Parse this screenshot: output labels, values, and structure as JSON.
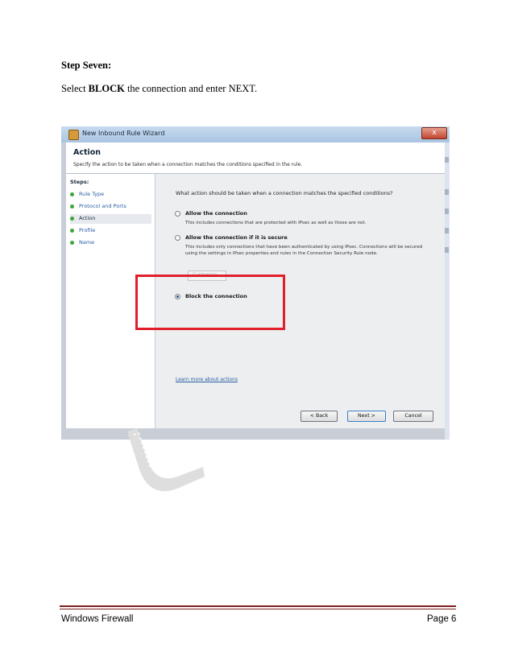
{
  "document": {
    "step_title": "Step Seven:",
    "instruction_prefix": "Select ",
    "instruction_bold": "BLOCK",
    "instruction_suffix": " the connection and enter NEXT."
  },
  "dialog": {
    "window_title": "New Inbound Rule Wizard",
    "close_label": "x",
    "header_title": "Action",
    "header_subtitle": "Specify the action to be taken when a connection matches the conditions specified in the rule.",
    "steps_header": "Steps:",
    "steps": [
      {
        "label": "Rule Type",
        "active": false
      },
      {
        "label": "Protocol and Ports",
        "active": false
      },
      {
        "label": "Action",
        "active": true
      },
      {
        "label": "Profile",
        "active": false
      },
      {
        "label": "Name",
        "active": false
      }
    ],
    "question": "What action should be taken when a connection matches the specified conditions?",
    "options": [
      {
        "label": "Allow the connection",
        "description": "This includes connections that are protected with IPsec as well as those are not.",
        "selected": false
      },
      {
        "label": "Allow the connection if it is secure",
        "description": "This includes only connections that have been authenticated by using IPsec. Connections will be secured using the settings in IPsec properties and rules in the Connection Security Rule node.",
        "selected": false
      },
      {
        "label": "Block the connection",
        "description": "",
        "selected": true
      }
    ],
    "customize_label": "Customize...",
    "learn_more": "Learn more about actions",
    "buttons": {
      "back": "< Back",
      "next": "Next >",
      "cancel": "Cancel"
    },
    "highlight_color": "#e21e2a"
  },
  "footer": {
    "left": "Windows Firewall",
    "right": "Page 6"
  }
}
